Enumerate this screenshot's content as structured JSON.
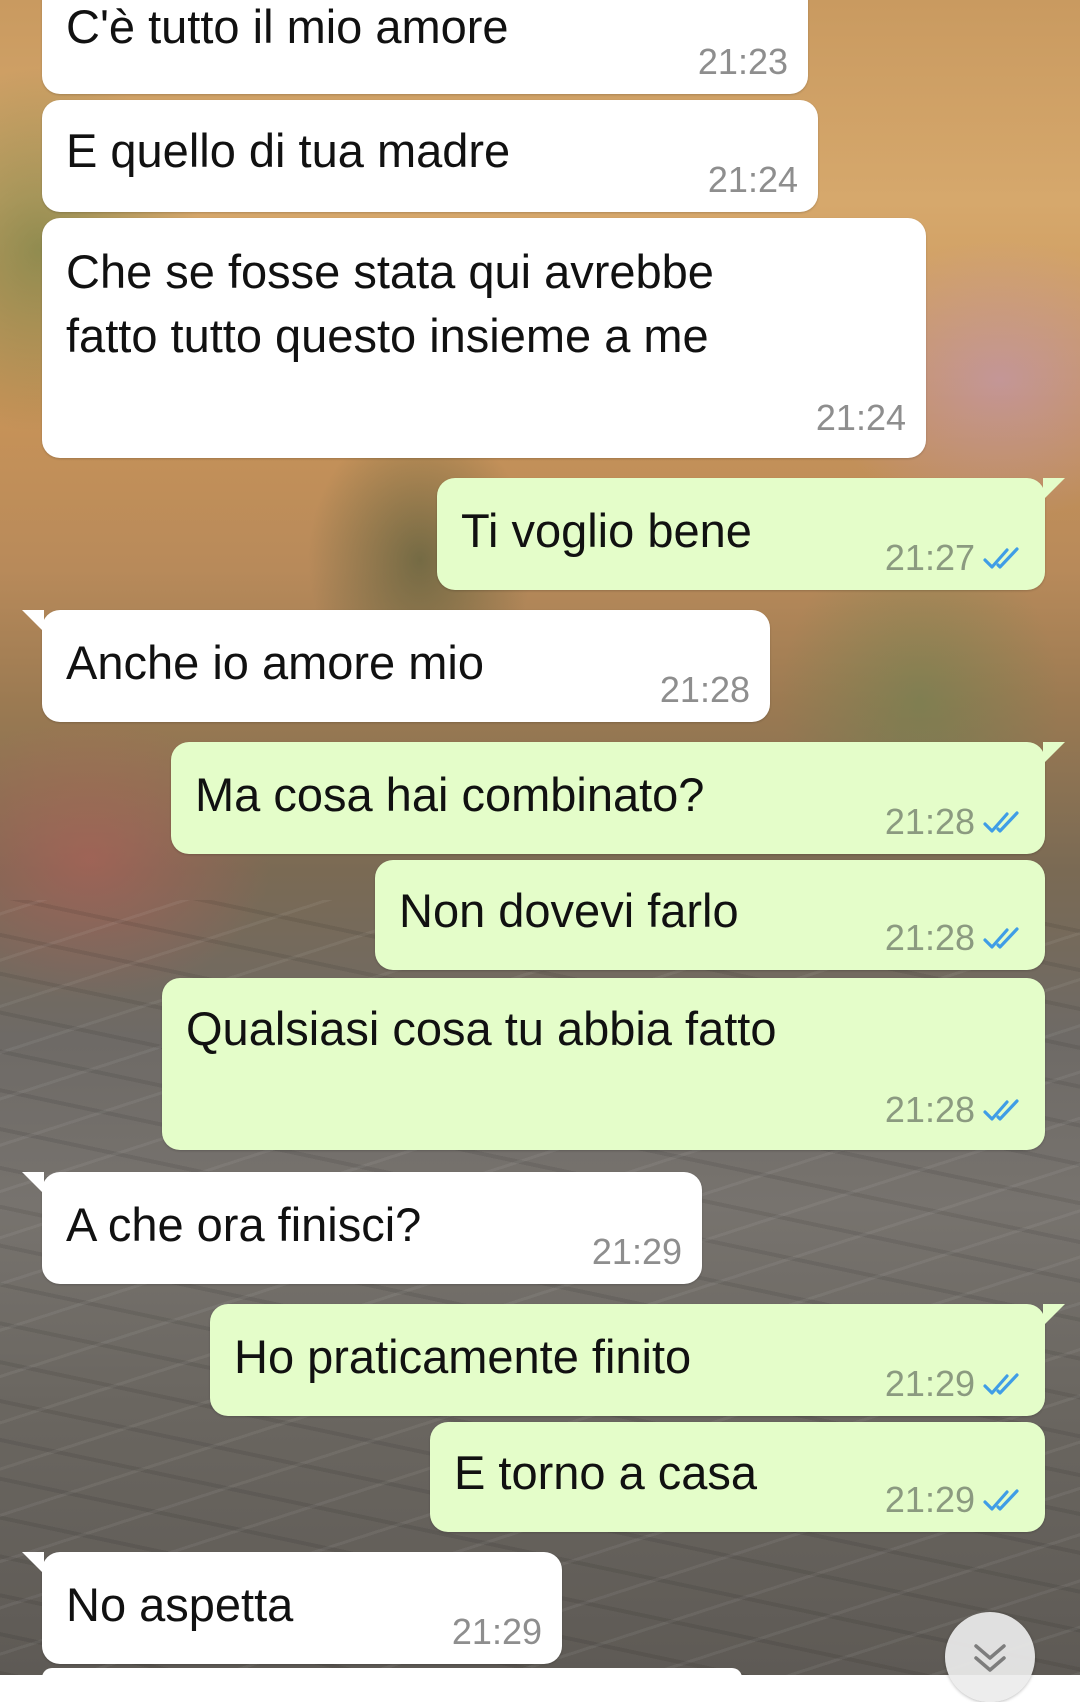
{
  "chat": {
    "messages": [
      {
        "direction": "incoming",
        "text": "C'è tutto il mio amore",
        "time": "21:23"
      },
      {
        "direction": "incoming",
        "text": "E quello di tua madre",
        "time": "21:24"
      },
      {
        "direction": "incoming",
        "text": "Che se fosse stata qui avrebbe\nfatto tutto questo insieme a me",
        "time": "21:24"
      },
      {
        "direction": "outgoing",
        "text": "Ti voglio bene",
        "time": "21:27",
        "status": "read"
      },
      {
        "direction": "incoming",
        "text": "Anche io amore mio",
        "time": "21:28"
      },
      {
        "direction": "outgoing",
        "text": "Ma cosa hai combinato?",
        "time": "21:28",
        "status": "read"
      },
      {
        "direction": "outgoing",
        "text": "Non dovevi farlo",
        "time": "21:28",
        "status": "read"
      },
      {
        "direction": "outgoing",
        "text": "Qualsiasi cosa tu abbia fatto",
        "time": "21:28",
        "status": "read"
      },
      {
        "direction": "incoming",
        "text": "A che ora finisci?",
        "time": "21:29"
      },
      {
        "direction": "outgoing",
        "text": "Ho praticamente finito",
        "time": "21:29",
        "status": "read"
      },
      {
        "direction": "outgoing",
        "text": "E torno a casa",
        "time": "21:29",
        "status": "read"
      },
      {
        "direction": "incoming",
        "text": "No aspetta",
        "time": "21:29"
      }
    ]
  },
  "colors": {
    "incoming_bubble": "#ffffff",
    "outgoing_bubble": "#e4fdc9",
    "read_tick": "#3f9de6",
    "timestamp": "#8e8e8e"
  },
  "icons": {
    "read_status": "double-check-icon",
    "scroll_down": "chevron-double-down-icon"
  }
}
